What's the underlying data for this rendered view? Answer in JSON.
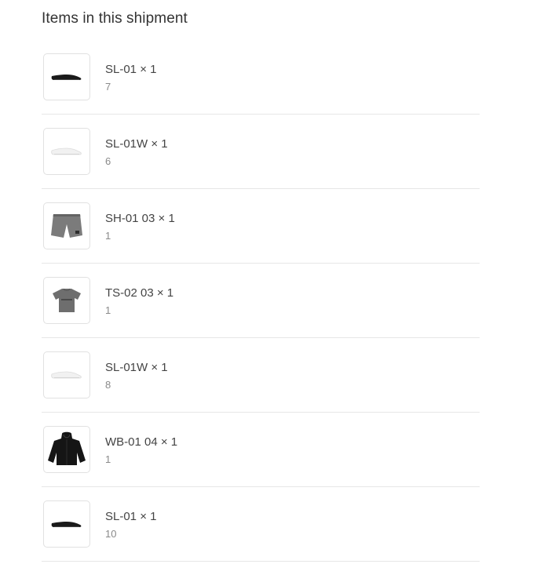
{
  "shipment": {
    "title": "Items in this shipment",
    "items": [
      {
        "name": "SL-01 × 1",
        "variant": "7",
        "icon": "black-slide-shoe-icon"
      },
      {
        "name": "SL-01W × 1",
        "variant": "6",
        "icon": "white-slide-shoe-icon"
      },
      {
        "name": "SH-01 03 × 1",
        "variant": "1",
        "icon": "grey-shorts-icon"
      },
      {
        "name": "TS-02 03 × 1",
        "variant": "1",
        "icon": "grey-tshirt-icon"
      },
      {
        "name": "SL-01W × 1",
        "variant": "8",
        "icon": "white-slide-shoe-icon"
      },
      {
        "name": "WB-01 04 × 1",
        "variant": "1",
        "icon": "black-jacket-icon"
      },
      {
        "name": "SL-01 × 1",
        "variant": "10",
        "icon": "black-slide-shoe-icon"
      }
    ]
  }
}
